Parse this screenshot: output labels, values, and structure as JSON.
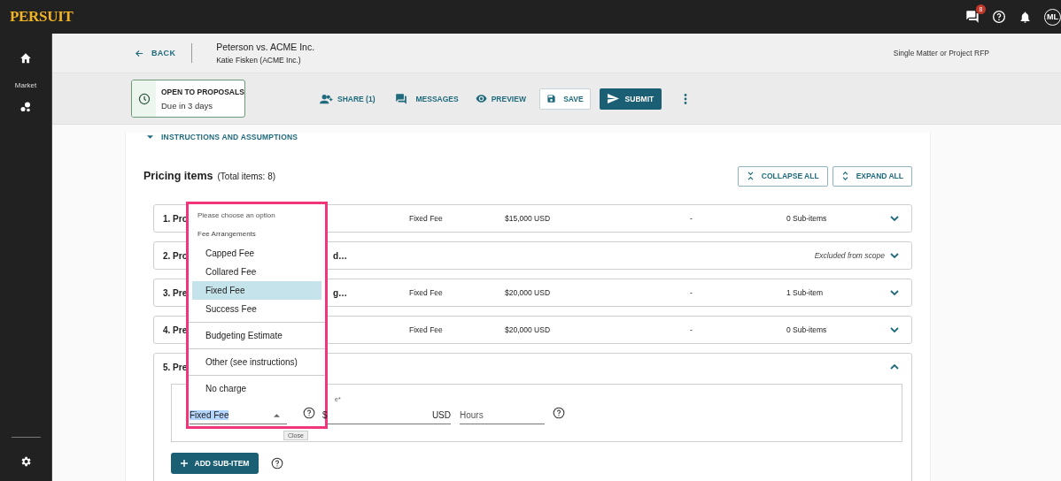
{
  "brand": "PERSUIT",
  "top_bar": {
    "message_badge": "8",
    "avatar": "ML"
  },
  "sidebar": {
    "section_label": "Market"
  },
  "header": {
    "back": "BACK",
    "title": "Peterson vs. ACME Inc.",
    "subtitle": "Katie Fisken (ACME Inc.)",
    "rfp_type": "Single Matter or Project RFP"
  },
  "status": {
    "label": "OPEN TO PROPOSALS",
    "due": "Due in 3 days"
  },
  "toolbar": {
    "share": "SHARE (1)",
    "messages": "MESSAGES",
    "preview": "PREVIEW",
    "save": "SAVE",
    "submit": "SUBMIT"
  },
  "instructions": {
    "label": "INSTRUCTIONS AND ASSUMPTIONS"
  },
  "pricing": {
    "title": "Pricing items",
    "count": "(Total items: 8)",
    "collapse_all": "COLLAPSE ALL",
    "expand_all": "EXPAND ALL"
  },
  "rows": [
    {
      "title": "1. Pro",
      "fee_type": "Fixed Fee",
      "price": "$15,000 USD",
      "column_4": "-",
      "sub_items": "0 Sub-items",
      "expanded": false
    },
    {
      "title": "2. Pro",
      "title_tail": "d…",
      "note": "Excluded from scope",
      "expanded": false
    },
    {
      "title": "3. Pre",
      "title_tail": "g…",
      "fee_type": "Fixed Fee",
      "price": "$20,000 USD",
      "column_4": "-",
      "sub_items": "1 Sub-item",
      "expanded": false
    },
    {
      "title": "4. Pre",
      "fee_type": "Fixed Fee",
      "price": "$20,000 USD",
      "column_4": "-",
      "sub_items": "0 Sub-items",
      "expanded": false
    },
    {
      "title": "5. Pre",
      "expanded": true
    }
  ],
  "sub_item": {
    "field_label": "e*",
    "fee_select": "Fixed Fee",
    "currency_symbol": "$",
    "currency": "USD",
    "hours_placeholder": "Hours"
  },
  "add_sub_item": "ADD SUB-ITEM",
  "dropdown": {
    "prompt": "Please choose an option",
    "group": "Fee Arrangements",
    "options": [
      {
        "label": "Capped Fee",
        "selected": false,
        "divider_before": false
      },
      {
        "label": "Collared Fee",
        "selected": false,
        "divider_before": false
      },
      {
        "label": "Fixed Fee",
        "selected": true,
        "divider_before": false
      },
      {
        "label": "Success Fee",
        "selected": false,
        "divider_before": false
      },
      {
        "label": "Budgeting Estimate",
        "selected": false,
        "divider_before": true
      },
      {
        "label": "Other (see instructions)",
        "selected": false,
        "divider_before": true
      },
      {
        "label": "No charge",
        "selected": false,
        "divider_before": true
      }
    ]
  },
  "tooltip": "Close"
}
